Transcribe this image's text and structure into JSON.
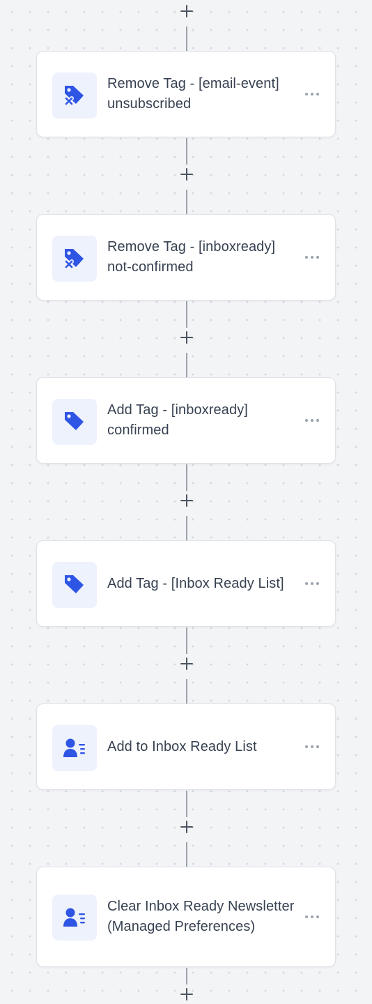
{
  "theme": {
    "accent": "#2f55e4",
    "icon_bg": "#eef2fd",
    "connector": "#9aa0a9",
    "canvas_bg": "#f3f4f6"
  },
  "workflow": {
    "steps": [
      {
        "label": "Remove Tag - [email-event] unsubscribed",
        "icon": "tag-remove-icon"
      },
      {
        "label": "Remove Tag - [inboxready] not-confirmed",
        "icon": "tag-remove-icon"
      },
      {
        "label": "Add Tag - [inboxready] confirmed",
        "icon": "tag-icon"
      },
      {
        "label": "Add Tag - [Inbox Ready List]",
        "icon": "tag-icon"
      },
      {
        "label": "Add to Inbox Ready List",
        "icon": "user-list-icon"
      },
      {
        "label": "Clear Inbox Ready Newsletter (Managed Preferences)",
        "icon": "user-list-icon"
      }
    ]
  }
}
